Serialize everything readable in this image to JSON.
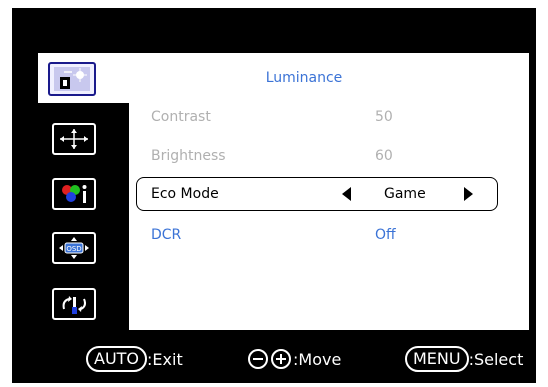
{
  "menu": {
    "title": "Luminance",
    "rows": [
      {
        "label": "Contrast",
        "value": "50"
      },
      {
        "label": "Brightness",
        "value": "60"
      },
      {
        "label": "Eco Mode",
        "value": "Game"
      },
      {
        "label": "DCR",
        "value": "Off"
      }
    ]
  },
  "sidebar": {
    "icons": [
      "luminance-icon",
      "image-setup-icon",
      "color-setup-icon",
      "osd-setup-icon",
      "extra-icon"
    ]
  },
  "footer": {
    "auto_key": "AUTO",
    "auto_action": ":Exit",
    "move_action": ":Move",
    "menu_key": "MENU",
    "menu_action": ":Select"
  },
  "colors": {
    "accent": "#3b73d6",
    "disabled": "#b0b0b0",
    "background": "#000000"
  }
}
